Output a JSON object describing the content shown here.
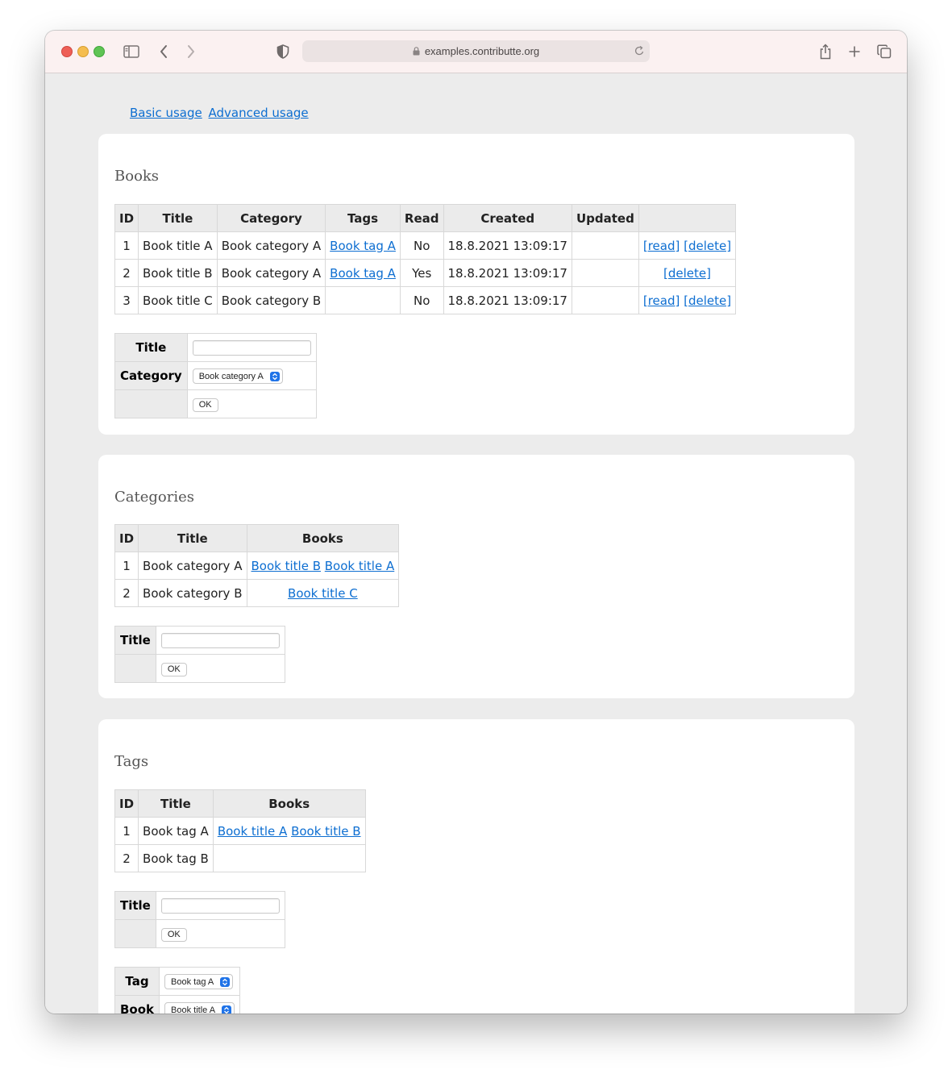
{
  "browser": {
    "url": "examples.contributte.org"
  },
  "top_links": {
    "basic": "Basic usage",
    "advanced": "Advanced usage"
  },
  "books": {
    "heading": "Books",
    "columns": [
      "ID",
      "Title",
      "Category",
      "Tags",
      "Read",
      "Created",
      "Updated",
      ""
    ],
    "rows": [
      {
        "id": "1",
        "title": "Book title A",
        "category": "Book category A",
        "tags": "Book tag A",
        "read": "No",
        "created": "18.8.2021 13:09:17",
        "updated": "",
        "read_action": "[read]",
        "delete_action": "[delete]"
      },
      {
        "id": "2",
        "title": "Book title B",
        "category": "Book category A",
        "tags": "Book tag A",
        "read": "Yes",
        "created": "18.8.2021 13:09:17",
        "updated": "",
        "delete_action": "[delete]"
      },
      {
        "id": "3",
        "title": "Book title C",
        "category": "Book category B",
        "tags": "",
        "read": "No",
        "created": "18.8.2021 13:09:17",
        "updated": "",
        "read_action": "[read]",
        "delete_action": "[delete]"
      }
    ],
    "form": {
      "title_label": "Title",
      "title_value": "",
      "category_label": "Category",
      "category_value": "Book category A",
      "submit": "OK"
    }
  },
  "categories": {
    "heading": "Categories",
    "columns": [
      "ID",
      "Title",
      "Books"
    ],
    "rows": [
      {
        "id": "1",
        "title": "Book category A",
        "books": [
          "Book title B",
          "Book title A"
        ]
      },
      {
        "id": "2",
        "title": "Book category B",
        "books": [
          "Book title C"
        ]
      }
    ],
    "form": {
      "title_label": "Title",
      "title_value": "",
      "submit": "OK"
    }
  },
  "tags": {
    "heading": "Tags",
    "columns": [
      "ID",
      "Title",
      "Books"
    ],
    "rows": [
      {
        "id": "1",
        "title": "Book tag A",
        "books": [
          "Book title A",
          "Book title B"
        ]
      },
      {
        "id": "2",
        "title": "Book tag B",
        "books": []
      }
    ],
    "form": {
      "title_label": "Title",
      "title_value": "",
      "submit": "OK"
    },
    "assign_form": {
      "tag_label": "Tag",
      "tag_value": "Book tag A",
      "book_label": "Book",
      "book_value": "Book title A"
    }
  }
}
